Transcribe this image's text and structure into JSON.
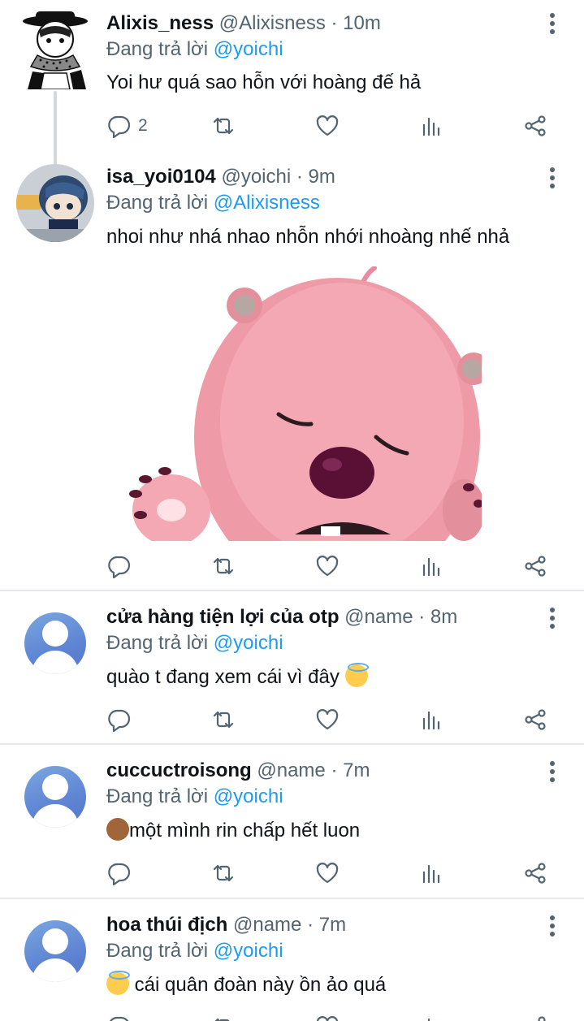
{
  "tweets": [
    {
      "name": "Alixis_ness",
      "handle": "@Alixisness",
      "dot": "·",
      "time": "10m",
      "replying_prefix": "Đang trả lời",
      "replying_to": "@yoichi",
      "text": "Yoi hư quá sao hỗn với hoàng đế hả",
      "reply_count": "2",
      "avatar": "manga-character-avatar"
    },
    {
      "name": "isa_yoi0104",
      "handle": "@yoichi",
      "dot": "·",
      "time": "9m",
      "replying_prefix": "Đang trả lời",
      "replying_to": "@Alixisness",
      "text": "nhoi như nhá nhao nhỗn nhới nhoàng nhế nhả",
      "avatar": "plush-doll-avatar",
      "media": "pink-beaver-sticker"
    },
    {
      "name": "cửa hàng tiện lợi của otp",
      "handle": "@name",
      "dot": "·",
      "time": "8m",
      "replying_prefix": "Đang trả lời",
      "replying_to": "@yoichi",
      "text": "quào t đang xem cái vì đây",
      "avatar": "default-avatar",
      "emoji": "smiling-face-with-halo"
    },
    {
      "name": "cuccuctroisong",
      "handle": "@name",
      "dot": "·",
      "time": "7m",
      "replying_prefix": "Đang trả lời",
      "replying_to": "@yoichi",
      "text": "một mình rin chấp hết luon",
      "avatar": "default-avatar",
      "emoji": "see-no-evil-monkey"
    },
    {
      "name": "hoa thúi địch",
      "handle": "@name",
      "dot": "·",
      "time": "7m",
      "replying_prefix": "Đang trả lời",
      "replying_to": "@yoichi",
      "text": "cái quân đoàn này ồn ảo quá",
      "avatar": "default-avatar",
      "emoji": "smiling-face-with-halo"
    }
  ],
  "colors": {
    "link": "#1d9bf0",
    "secondary_text": "#536471",
    "primary_text": "#0f1419",
    "separator": "#e6e8eb",
    "default_avatar": "#6a8fd6"
  }
}
